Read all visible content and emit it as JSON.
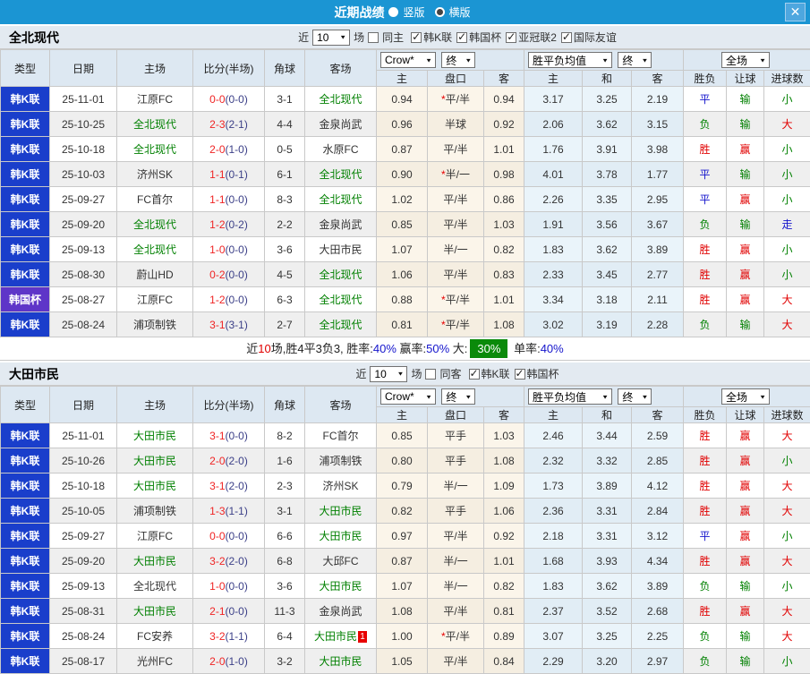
{
  "titlebar": {
    "title": "近期战绩",
    "vertical_label": "竖版",
    "vertical_checked": false,
    "horizontal_label": "横版",
    "horizontal_checked": true,
    "close_label": "✕"
  },
  "colors": {
    "titlebar": "#1b95d3",
    "kleague_badge": "#1a3ecb",
    "cup_badge": "#5e35c8",
    "team_highlight": "#008000",
    "score_fulltime": "#ef2424",
    "win": "#e10000",
    "draw": "#1414cc",
    "lose": "#008000",
    "summary_badge": "#0a8a0a"
  },
  "sections": [
    {
      "team": "全北现代",
      "filter": {
        "near_label": "近",
        "games_value": "10",
        "games_label": "场",
        "same_label": "同主",
        "same_checked": false,
        "leagues": [
          {
            "label": "韩K联",
            "checked": true
          },
          {
            "label": "韩国杯",
            "checked": true
          },
          {
            "label": "亚冠联2",
            "checked": true
          },
          {
            "label": "国际友谊",
            "checked": true
          }
        ]
      },
      "header": {
        "type": "类型",
        "date": "日期",
        "home": "主场",
        "score": "比分(半场)",
        "corner": "角球",
        "away": "客场",
        "odds_select": "Crow*",
        "odds_final": "终",
        "avg_select": "胜平负均值",
        "avg_final": "终",
        "period_select": "全场",
        "sub": [
          "主",
          "盘口",
          "客",
          "主",
          "和",
          "客",
          "胜负",
          "让球",
          "进球数"
        ]
      },
      "rows": [
        {
          "type": "韩K联",
          "type_key": "kl",
          "date": "25-11-01",
          "home": "江原FC",
          "home_hl": false,
          "ft": "0-0",
          "ht": "(0-0)",
          "corner": "3-1",
          "away": "全北现代",
          "away_hl": true,
          "away_badge": "",
          "o1": "0.94",
          "line": "平/半",
          "star": true,
          "o2": "0.94",
          "a1": "3.17",
          "a2": "3.25",
          "a3": "2.19",
          "r1": [
            "平",
            "blue"
          ],
          "r2": [
            "输",
            "green"
          ],
          "r3": [
            "小",
            "green"
          ]
        },
        {
          "type": "韩K联",
          "type_key": "kl",
          "date": "25-10-25",
          "home": "全北现代",
          "home_hl": true,
          "ft": "2-3",
          "ht": "(2-1)",
          "corner": "4-4",
          "away": "金泉尚武",
          "away_hl": false,
          "away_badge": "",
          "o1": "0.96",
          "line": "半球",
          "star": false,
          "o2": "0.92",
          "a1": "2.06",
          "a2": "3.62",
          "a3": "3.15",
          "r1": [
            "负",
            "green"
          ],
          "r2": [
            "输",
            "green"
          ],
          "r3": [
            "大",
            "red"
          ]
        },
        {
          "type": "韩K联",
          "type_key": "kl",
          "date": "25-10-18",
          "home": "全北现代",
          "home_hl": true,
          "ft": "2-0",
          "ht": "(1-0)",
          "corner": "0-5",
          "away": "水原FC",
          "away_hl": false,
          "away_badge": "",
          "o1": "0.87",
          "line": "平/半",
          "star": false,
          "o2": "1.01",
          "a1": "1.76",
          "a2": "3.91",
          "a3": "3.98",
          "r1": [
            "胜",
            "red"
          ],
          "r2": [
            "赢",
            "red"
          ],
          "r3": [
            "小",
            "green"
          ]
        },
        {
          "type": "韩K联",
          "type_key": "kl",
          "date": "25-10-03",
          "home": "济州SK",
          "home_hl": false,
          "ft": "1-1",
          "ht": "(0-1)",
          "corner": "6-1",
          "away": "全北现代",
          "away_hl": true,
          "away_badge": "",
          "o1": "0.90",
          "line": "半/一",
          "star": true,
          "o2": "0.98",
          "a1": "4.01",
          "a2": "3.78",
          "a3": "1.77",
          "r1": [
            "平",
            "blue"
          ],
          "r2": [
            "输",
            "green"
          ],
          "r3": [
            "小",
            "green"
          ]
        },
        {
          "type": "韩K联",
          "type_key": "kl",
          "date": "25-09-27",
          "home": "FC首尔",
          "home_hl": false,
          "ft": "1-1",
          "ht": "(0-0)",
          "corner": "8-3",
          "away": "全北现代",
          "away_hl": true,
          "away_badge": "",
          "o1": "1.02",
          "line": "平/半",
          "star": false,
          "o2": "0.86",
          "a1": "2.26",
          "a2": "3.35",
          "a3": "2.95",
          "r1": [
            "平",
            "blue"
          ],
          "r2": [
            "赢",
            "red"
          ],
          "r3": [
            "小",
            "green"
          ]
        },
        {
          "type": "韩K联",
          "type_key": "kl",
          "date": "25-09-20",
          "home": "全北现代",
          "home_hl": true,
          "ft": "1-2",
          "ht": "(0-2)",
          "corner": "2-2",
          "away": "金泉尚武",
          "away_hl": false,
          "away_badge": "",
          "o1": "0.85",
          "line": "平/半",
          "star": false,
          "o2": "1.03",
          "a1": "1.91",
          "a2": "3.56",
          "a3": "3.67",
          "r1": [
            "负",
            "green"
          ],
          "r2": [
            "输",
            "green"
          ],
          "r3": [
            "走",
            "blue"
          ]
        },
        {
          "type": "韩K联",
          "type_key": "kl",
          "date": "25-09-13",
          "home": "全北现代",
          "home_hl": true,
          "ft": "1-0",
          "ht": "(0-0)",
          "corner": "3-6",
          "away": "大田市民",
          "away_hl": false,
          "away_badge": "",
          "o1": "1.07",
          "line": "半/一",
          "star": false,
          "o2": "0.82",
          "a1": "1.83",
          "a2": "3.62",
          "a3": "3.89",
          "r1": [
            "胜",
            "red"
          ],
          "r2": [
            "赢",
            "red"
          ],
          "r3": [
            "小",
            "green"
          ]
        },
        {
          "type": "韩K联",
          "type_key": "kl",
          "date": "25-08-30",
          "home": "蔚山HD",
          "home_hl": false,
          "ft": "0-2",
          "ht": "(0-0)",
          "corner": "4-5",
          "away": "全北现代",
          "away_hl": true,
          "away_badge": "",
          "o1": "1.06",
          "line": "平/半",
          "star": false,
          "o2": "0.83",
          "a1": "2.33",
          "a2": "3.45",
          "a3": "2.77",
          "r1": [
            "胜",
            "red"
          ],
          "r2": [
            "赢",
            "red"
          ],
          "r3": [
            "小",
            "green"
          ]
        },
        {
          "type": "韩国杯",
          "type_key": "cup",
          "date": "25-08-27",
          "home": "江原FC",
          "home_hl": false,
          "ft": "1-2",
          "ht": "(0-0)",
          "corner": "6-3",
          "away": "全北现代",
          "away_hl": true,
          "away_badge": "",
          "o1": "0.88",
          "line": "平/半",
          "star": true,
          "o2": "1.01",
          "a1": "3.34",
          "a2": "3.18",
          "a3": "2.11",
          "r1": [
            "胜",
            "red"
          ],
          "r2": [
            "赢",
            "red"
          ],
          "r3": [
            "大",
            "red"
          ]
        },
        {
          "type": "韩K联",
          "type_key": "kl",
          "date": "25-08-24",
          "home": "浦项制铁",
          "home_hl": false,
          "ft": "3-1",
          "ht": "(3-1)",
          "corner": "2-7",
          "away": "全北现代",
          "away_hl": true,
          "away_badge": "",
          "o1": "0.81",
          "line": "平/半",
          "star": true,
          "o2": "1.08",
          "a1": "3.02",
          "a2": "3.19",
          "a3": "2.28",
          "r1": [
            "负",
            "green"
          ],
          "r2": [
            "输",
            "green"
          ],
          "r3": [
            "大",
            "red"
          ]
        }
      ],
      "summary": {
        "parts": [
          {
            "t": "近",
            "c": "black"
          },
          {
            "t": "10",
            "c": "red"
          },
          {
            "t": "场,胜4平3负3, 胜率:",
            "c": "black"
          },
          {
            "t": "40%",
            "c": "blue"
          },
          {
            "t": " 赢率:",
            "c": "black"
          },
          {
            "t": "50%",
            "c": "blue"
          },
          {
            "t": " 大:",
            "c": "black"
          },
          {
            "t": "30%",
            "c": "badge"
          },
          {
            "t": " 单率:",
            "c": "black"
          },
          {
            "t": "40%",
            "c": "blue"
          }
        ]
      }
    },
    {
      "team": "大田市民",
      "filter": {
        "near_label": "近",
        "games_value": "10",
        "games_label": "场",
        "same_label": "同客",
        "same_checked": false,
        "leagues": [
          {
            "label": "韩K联",
            "checked": true
          },
          {
            "label": "韩国杯",
            "checked": true
          }
        ]
      },
      "header": {
        "type": "类型",
        "date": "日期",
        "home": "主场",
        "score": "比分(半场)",
        "corner": "角球",
        "away": "客场",
        "odds_select": "Crow*",
        "odds_final": "终",
        "avg_select": "胜平负均值",
        "avg_final": "终",
        "period_select": "全场",
        "sub": [
          "主",
          "盘口",
          "客",
          "主",
          "和",
          "客",
          "胜负",
          "让球",
          "进球数"
        ]
      },
      "rows": [
        {
          "type": "韩K联",
          "type_key": "kl",
          "date": "25-11-01",
          "home": "大田市民",
          "home_hl": true,
          "ft": "3-1",
          "ht": "(0-0)",
          "corner": "8-2",
          "away": "FC首尔",
          "away_hl": false,
          "away_badge": "",
          "o1": "0.85",
          "line": "平手",
          "star": false,
          "o2": "1.03",
          "a1": "2.46",
          "a2": "3.44",
          "a3": "2.59",
          "r1": [
            "胜",
            "red"
          ],
          "r2": [
            "赢",
            "red"
          ],
          "r3": [
            "大",
            "red"
          ]
        },
        {
          "type": "韩K联",
          "type_key": "kl",
          "date": "25-10-26",
          "home": "大田市民",
          "home_hl": true,
          "ft": "2-0",
          "ht": "(2-0)",
          "corner": "1-6",
          "away": "浦项制铁",
          "away_hl": false,
          "away_badge": "",
          "o1": "0.80",
          "line": "平手",
          "star": false,
          "o2": "1.08",
          "a1": "2.32",
          "a2": "3.32",
          "a3": "2.85",
          "r1": [
            "胜",
            "red"
          ],
          "r2": [
            "赢",
            "red"
          ],
          "r3": [
            "小",
            "green"
          ]
        },
        {
          "type": "韩K联",
          "type_key": "kl",
          "date": "25-10-18",
          "home": "大田市民",
          "home_hl": true,
          "ft": "3-1",
          "ht": "(2-0)",
          "corner": "2-3",
          "away": "济州SK",
          "away_hl": false,
          "away_badge": "",
          "o1": "0.79",
          "line": "半/一",
          "star": false,
          "o2": "1.09",
          "a1": "1.73",
          "a2": "3.89",
          "a3": "4.12",
          "r1": [
            "胜",
            "red"
          ],
          "r2": [
            "赢",
            "red"
          ],
          "r3": [
            "大",
            "red"
          ]
        },
        {
          "type": "韩K联",
          "type_key": "kl",
          "date": "25-10-05",
          "home": "浦项制铁",
          "home_hl": false,
          "ft": "1-3",
          "ht": "(1-1)",
          "corner": "3-1",
          "away": "大田市民",
          "away_hl": true,
          "away_badge": "",
          "o1": "0.82",
          "line": "平手",
          "star": false,
          "o2": "1.06",
          "a1": "2.36",
          "a2": "3.31",
          "a3": "2.84",
          "r1": [
            "胜",
            "red"
          ],
          "r2": [
            "赢",
            "red"
          ],
          "r3": [
            "大",
            "red"
          ]
        },
        {
          "type": "韩K联",
          "type_key": "kl",
          "date": "25-09-27",
          "home": "江原FC",
          "home_hl": false,
          "ft": "0-0",
          "ht": "(0-0)",
          "corner": "6-6",
          "away": "大田市民",
          "away_hl": true,
          "away_badge": "",
          "o1": "0.97",
          "line": "平/半",
          "star": false,
          "o2": "0.92",
          "a1": "2.18",
          "a2": "3.31",
          "a3": "3.12",
          "r1": [
            "平",
            "blue"
          ],
          "r2": [
            "赢",
            "red"
          ],
          "r3": [
            "小",
            "green"
          ]
        },
        {
          "type": "韩K联",
          "type_key": "kl",
          "date": "25-09-20",
          "home": "大田市民",
          "home_hl": true,
          "ft": "3-2",
          "ht": "(2-0)",
          "corner": "6-8",
          "away": "大邱FC",
          "away_hl": false,
          "away_badge": "",
          "o1": "0.87",
          "line": "半/一",
          "star": false,
          "o2": "1.01",
          "a1": "1.68",
          "a2": "3.93",
          "a3": "4.34",
          "r1": [
            "胜",
            "red"
          ],
          "r2": [
            "赢",
            "red"
          ],
          "r3": [
            "大",
            "red"
          ]
        },
        {
          "type": "韩K联",
          "type_key": "kl",
          "date": "25-09-13",
          "home": "全北现代",
          "home_hl": false,
          "ft": "1-0",
          "ht": "(0-0)",
          "corner": "3-6",
          "away": "大田市民",
          "away_hl": true,
          "away_badge": "",
          "o1": "1.07",
          "line": "半/一",
          "star": false,
          "o2": "0.82",
          "a1": "1.83",
          "a2": "3.62",
          "a3": "3.89",
          "r1": [
            "负",
            "green"
          ],
          "r2": [
            "输",
            "green"
          ],
          "r3": [
            "小",
            "green"
          ]
        },
        {
          "type": "韩K联",
          "type_key": "kl",
          "date": "25-08-31",
          "home": "大田市民",
          "home_hl": true,
          "ft": "2-1",
          "ht": "(0-0)",
          "corner": "11-3",
          "away": "金泉尚武",
          "away_hl": false,
          "away_badge": "",
          "o1": "1.08",
          "line": "平/半",
          "star": false,
          "o2": "0.81",
          "a1": "2.37",
          "a2": "3.52",
          "a3": "2.68",
          "r1": [
            "胜",
            "red"
          ],
          "r2": [
            "赢",
            "red"
          ],
          "r3": [
            "大",
            "red"
          ]
        },
        {
          "type": "韩K联",
          "type_key": "kl",
          "date": "25-08-24",
          "home": "FC安养",
          "home_hl": false,
          "ft": "3-2",
          "ht": "(1-1)",
          "corner": "6-4",
          "away": "大田市民",
          "away_hl": true,
          "away_badge": "1",
          "o1": "1.00",
          "line": "平/半",
          "star": true,
          "o2": "0.89",
          "a1": "3.07",
          "a2": "3.25",
          "a3": "2.25",
          "r1": [
            "负",
            "green"
          ],
          "r2": [
            "输",
            "green"
          ],
          "r3": [
            "大",
            "red"
          ]
        },
        {
          "type": "韩K联",
          "type_key": "kl",
          "date": "25-08-17",
          "home": "光州FC",
          "home_hl": false,
          "ft": "2-0",
          "ht": "(1-0)",
          "corner": "3-2",
          "away": "大田市民",
          "away_hl": true,
          "away_badge": "",
          "o1": "1.05",
          "line": "平/半",
          "star": false,
          "o2": "0.84",
          "a1": "2.29",
          "a2": "3.20",
          "a3": "2.97",
          "r1": [
            "负",
            "green"
          ],
          "r2": [
            "输",
            "green"
          ],
          "r3": [
            "小",
            "green"
          ]
        }
      ],
      "summary": null
    }
  ]
}
